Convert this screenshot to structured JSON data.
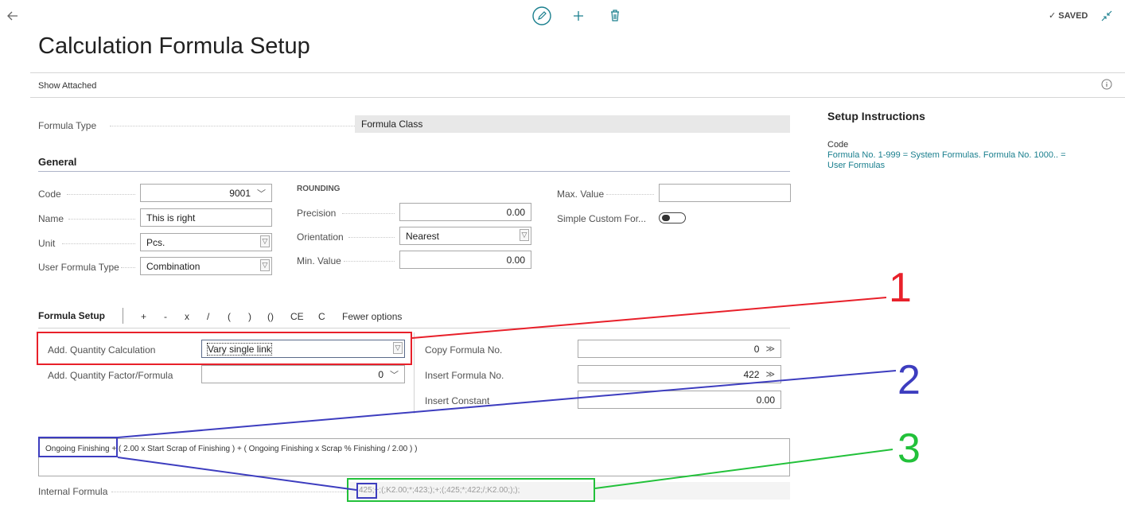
{
  "topbar": {
    "back_icon": "arrow-left-icon",
    "edit_icon": "pencil-icon",
    "new_icon": "plus-icon",
    "delete_icon": "trash-icon",
    "saved_label": "✓ SAVED",
    "collapse_icon": "collapse-icon"
  },
  "page": {
    "title": "Calculation Formula Setup",
    "action_show_attached": "Show Attached",
    "info_icon": "info-icon"
  },
  "formula_type": {
    "label": "Formula Type",
    "value": "Formula Class"
  },
  "general": {
    "heading": "General",
    "code": {
      "label": "Code",
      "value": "9001"
    },
    "name": {
      "label": "Name",
      "value": "This is right"
    },
    "unit": {
      "label": "Unit",
      "value": "Pcs."
    },
    "user_formula_type": {
      "label": "User Formula Type",
      "value": "Combination"
    },
    "rounding_heading": "ROUNDING",
    "precision": {
      "label": "Precision",
      "value": "0.00"
    },
    "orientation": {
      "label": "Orientation",
      "value": "Nearest"
    },
    "min_value": {
      "label": "Min. Value",
      "value": "0.00"
    },
    "max_value": {
      "label": "Max. Value",
      "value": ""
    },
    "simple_custom": {
      "label": "Simple Custom For...",
      "enabled": false
    }
  },
  "formula_setup": {
    "heading": "Formula Setup",
    "ops": [
      "+",
      "-",
      "x",
      "/",
      "(",
      ")",
      "()",
      "CE",
      "C"
    ],
    "fewer_options": "Fewer options",
    "add_qty_calc": {
      "label": "Add. Quantity Calculation",
      "value": "Vary single link"
    },
    "add_qty_factor": {
      "label": "Add. Quantity Factor/Formula",
      "value": "0"
    },
    "copy_formula": {
      "label": "Copy Formula No.",
      "value": "0"
    },
    "insert_formula": {
      "label": "Insert Formula No.",
      "value": "422"
    },
    "insert_constant": {
      "label": "Insert Constant",
      "value": "0.00"
    },
    "formula_text_highlight": "Ongoing Finishing",
    "formula_text_rest": " + ( 2.00 x Start Scrap of Finishing ) + ( Ongoing Finishing x Scrap % Finishing / 2.00 ) )",
    "internal_formula": {
      "label": "Internal Formula",
      "highlight": "425",
      "rest": ";+;(;K2.00;*;423;);+;(;425;*;422;/;K2.00;););"
    }
  },
  "instructions": {
    "heading": "Setup Instructions",
    "field": "Code",
    "text": "Formula No. 1-999 = System Formulas. Formula No. 1000.. = User Formulas"
  },
  "annotations": {
    "one": "1",
    "two": "2",
    "three": "3",
    "color_red": "#e8202a",
    "color_blue": "#3d3dbf",
    "color_green": "#22c13a"
  }
}
